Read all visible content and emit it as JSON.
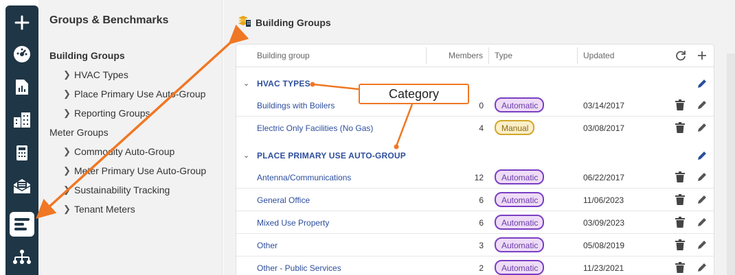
{
  "nav": {
    "title": "Groups & Benchmarks",
    "building_groups_label": "Building Groups",
    "building_children": [
      "HVAC Types",
      "Place Primary Use Auto-Group",
      "Reporting Groups"
    ],
    "meter_groups_label": "Meter Groups",
    "meter_children": [
      "Commodity Auto-Group",
      "Meter Primary Use Auto-Group",
      "Sustainability Tracking",
      "Tenant Meters"
    ]
  },
  "page": {
    "title": "Building Groups"
  },
  "table": {
    "headers": {
      "name": "Building group",
      "members": "Members",
      "type": "Type",
      "updated": "Updated"
    },
    "categories": [
      {
        "label": "HVAC TYPES",
        "rows": [
          {
            "name": "Buildings with Boilers",
            "members": "0",
            "type": "Automatic",
            "updated": "03/14/2017"
          },
          {
            "name": "Electric Only Facilities (No Gas)",
            "members": "4",
            "type": "Manual",
            "updated": "03/08/2017"
          }
        ]
      },
      {
        "label": "PLACE PRIMARY USE AUTO-GROUP",
        "rows": [
          {
            "name": "Antenna/Communications",
            "members": "12",
            "type": "Automatic",
            "updated": "06/22/2017"
          },
          {
            "name": "General Office",
            "members": "6",
            "type": "Automatic",
            "updated": "11/06/2023"
          },
          {
            "name": "Mixed Use Property",
            "members": "6",
            "type": "Automatic",
            "updated": "03/09/2023"
          },
          {
            "name": "Other",
            "members": "3",
            "type": "Automatic",
            "updated": "05/08/2019"
          },
          {
            "name": "Other - Public Services",
            "members": "2",
            "type": "Automatic",
            "updated": "11/23/2021"
          }
        ]
      }
    ]
  },
  "annotation": {
    "callout_label": "Category",
    "color": "#f07723"
  },
  "colors": {
    "rail": "#1f3646",
    "link": "#2d4e9c",
    "automatic_border": "#7a3fc2",
    "manual_border": "#d3a52a"
  },
  "icons": {
    "rail": [
      "plus-icon",
      "dashboard-gauge-icon",
      "report-chart-icon",
      "buildings-icon",
      "calculator-icon",
      "mail-icon",
      "groups-icon",
      "hierarchy-icon"
    ],
    "toolbar": [
      "refresh-icon",
      "plus-icon"
    ],
    "row": [
      "trash-icon",
      "pencil-icon"
    ]
  }
}
